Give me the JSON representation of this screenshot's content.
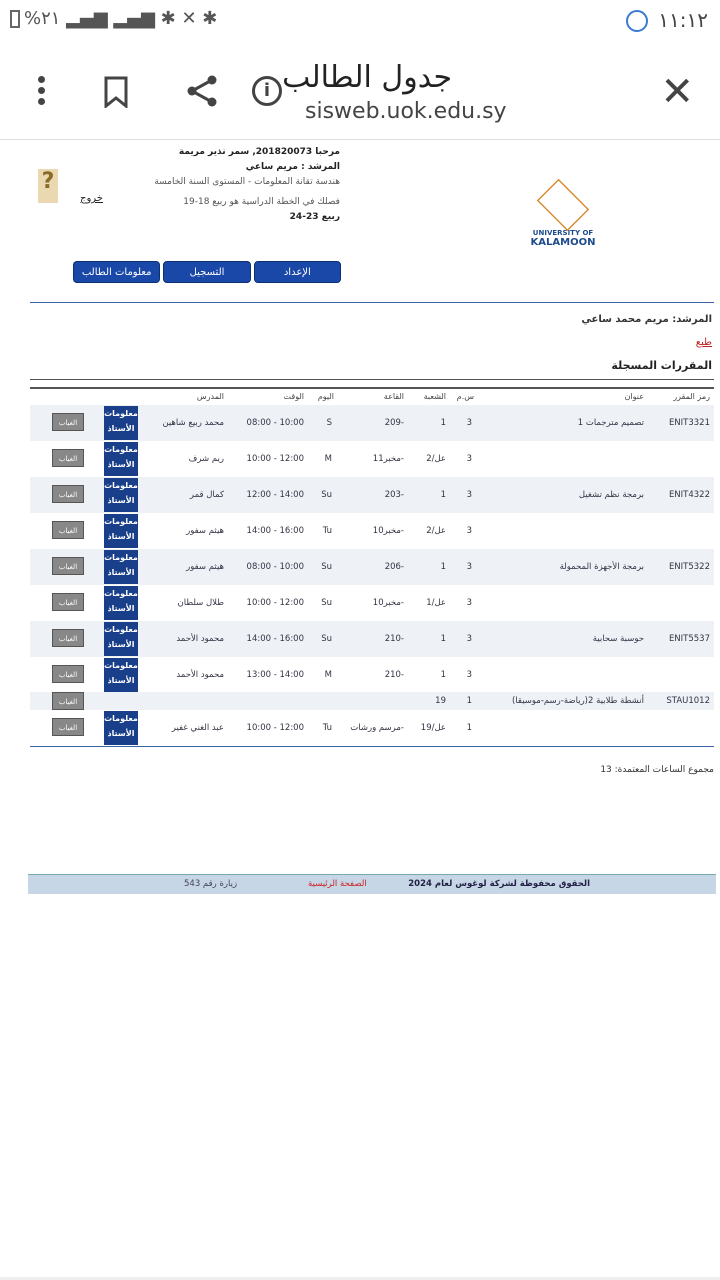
{
  "status": {
    "time": "١١:١٢",
    "battery": "%٢١"
  },
  "browser": {
    "title": "جدول الطالب",
    "url": "sisweb.uok.edu.sy"
  },
  "header": {
    "welcome": "مرحبا 201820073, سمر نذير مريمة",
    "advisor": "المرشد : مريم ساعي",
    "program": "هندسة تقانة المعلومات - المستوى السنة الخامسة",
    "plan_term": "فصلك في الخطة الدراسية هو ربيع 18-19",
    "term": "ربيع 23-24",
    "logout": "خروج",
    "logo_line1": "UNIVERSITY OF",
    "logo_line2": "KALAMOON"
  },
  "nav": {
    "prep": "الإعداد",
    "register": "التسجيل",
    "student_info": "معلومات الطالب"
  },
  "advisor_full": "المرشد: مريم محمد ساعي",
  "print": "طبع",
  "section_title": "المقررات المسجلة",
  "columns": {
    "code": "رمز المقرر",
    "title": "عنوان",
    "credits": "س.م",
    "section": "الشعبة",
    "room": "القاعة",
    "day": "اليوم",
    "time": "الوقت",
    "instructor": "المدرس"
  },
  "buttons": {
    "absence": "الغياب",
    "info": "معلومات الأستاذ"
  },
  "rows": [
    {
      "code": "ENIT3321",
      "title": "تصميم مترجمات 1",
      "credits": "3",
      "section": "1",
      "room": "209-",
      "day": "S",
      "time": "08:00 - 10:00",
      "instructor": "محمد ربيع شاهين"
    },
    {
      "code": "",
      "title": "",
      "credits": "3",
      "section": "2/عل",
      "room": "مخبر11-",
      "day": "M",
      "time": "10:00 - 12:00",
      "instructor": "ريم شرف"
    },
    {
      "code": "ENIT4322",
      "title": "برمجة نظم تشغيل",
      "credits": "3",
      "section": "1",
      "room": "203-",
      "day": "Su",
      "time": "12:00 - 14:00",
      "instructor": "كمال قمر"
    },
    {
      "code": "",
      "title": "",
      "credits": "3",
      "section": "2/عل",
      "room": "مخبر10-",
      "day": "Tu",
      "time": "14:00 - 16:00",
      "instructor": "هيثم سفور"
    },
    {
      "code": "ENIT5322",
      "title": "برمجة الأجهزة المحمولة",
      "credits": "3",
      "section": "1",
      "room": "206-",
      "day": "Su",
      "time": "08:00 - 10:00",
      "instructor": "هيثم سفور"
    },
    {
      "code": "",
      "title": "",
      "credits": "3",
      "section": "1/عل",
      "room": "مخبر10-",
      "day": "Su",
      "time": "10:00 - 12:00",
      "instructor": "طلال سلطان"
    },
    {
      "code": "ENIT5537",
      "title": "حوسبة سحابية",
      "credits": "3",
      "section": "1",
      "room": "210-",
      "day": "Su",
      "time": "14:00 - 16:00",
      "instructor": "محمود الأحمد"
    },
    {
      "code": "",
      "title": "",
      "credits": "3",
      "section": "1",
      "room": "210-",
      "day": "M",
      "time": "13:00 - 14:00",
      "instructor": "محمود الأحمد"
    },
    {
      "code": "STAU1012",
      "title": "أنشطة طلابية 2(رياضة-رسم-موسيقا)",
      "credits": "1",
      "section": "19",
      "room": "",
      "day": "",
      "time": "",
      "instructor": ""
    },
    {
      "code": "",
      "title": "",
      "credits": "1",
      "section": "19/عل",
      "room": "مرسم ورشات-",
      "day": "Tu",
      "time": "10:00 - 12:00",
      "instructor": "عبد الغني غفير"
    }
  ],
  "total": "مجموع الساعات المعتمدة: 13",
  "footer": {
    "copyright": "الحقوق محفوظة لشركة لوغوس لعام 2024",
    "home": "الصفحة الرئيسية",
    "visits": "زيارة رقم 543"
  }
}
